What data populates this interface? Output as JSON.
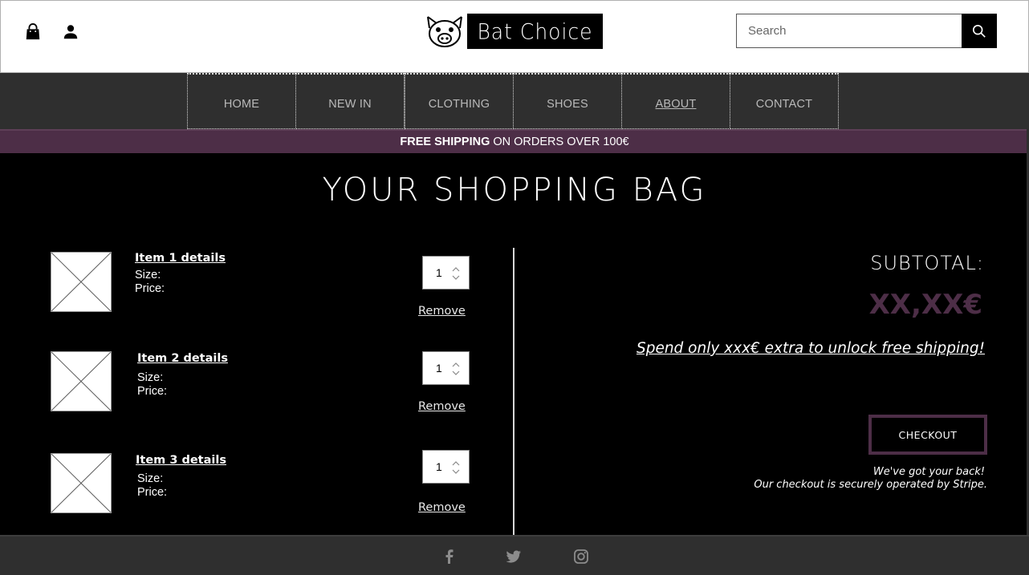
{
  "header": {
    "brand_name": "Bat Choice",
    "search_placeholder": "Search",
    "icons": [
      "bag-icon",
      "user-icon",
      "search-icon"
    ]
  },
  "nav": {
    "items": [
      {
        "label": "HOME"
      },
      {
        "label": "NEW IN"
      },
      {
        "label": "CLOTHING"
      },
      {
        "label": "SHOES"
      },
      {
        "label": "ABOUT"
      },
      {
        "label": "CONTACT"
      }
    ],
    "active": "ABOUT"
  },
  "banner": {
    "bold": "FREE SHIPPING",
    "rest": "ON ORDERS OVER 100€"
  },
  "page": {
    "title": "YOUR SHOPPING BAG"
  },
  "cart": {
    "items": [
      {
        "title": "Item 1 details",
        "size_label": "Size:",
        "price_label": "Price:",
        "qty": "1",
        "remove_label": "Remove"
      },
      {
        "title": "Item 2 details",
        "size_label": "Size:",
        "price_label": "Price:",
        "qty": "1",
        "remove_label": "Remove"
      },
      {
        "title": "Item 3 details",
        "size_label": "Size:",
        "price_label": "Price:",
        "qty": "1",
        "remove_label": "Remove"
      }
    ]
  },
  "summary": {
    "subtotal_label": "SUBTOTAL:",
    "subtotal_value": "XX,XX€",
    "promo": "Spend only xxx€ extra to unlock free shipping!",
    "checkout_label": "CHECKOUT",
    "secure_line1": "We've got your back!",
    "secure_line2": "Our checkout is securely operated by Stripe."
  },
  "footer": {
    "social": [
      "facebook-icon",
      "twitter-icon",
      "instagram-icon"
    ]
  },
  "colors": {
    "accent": "#4d2e47",
    "nav_bg": "#2f2f2f",
    "page_bg": "#000000"
  }
}
